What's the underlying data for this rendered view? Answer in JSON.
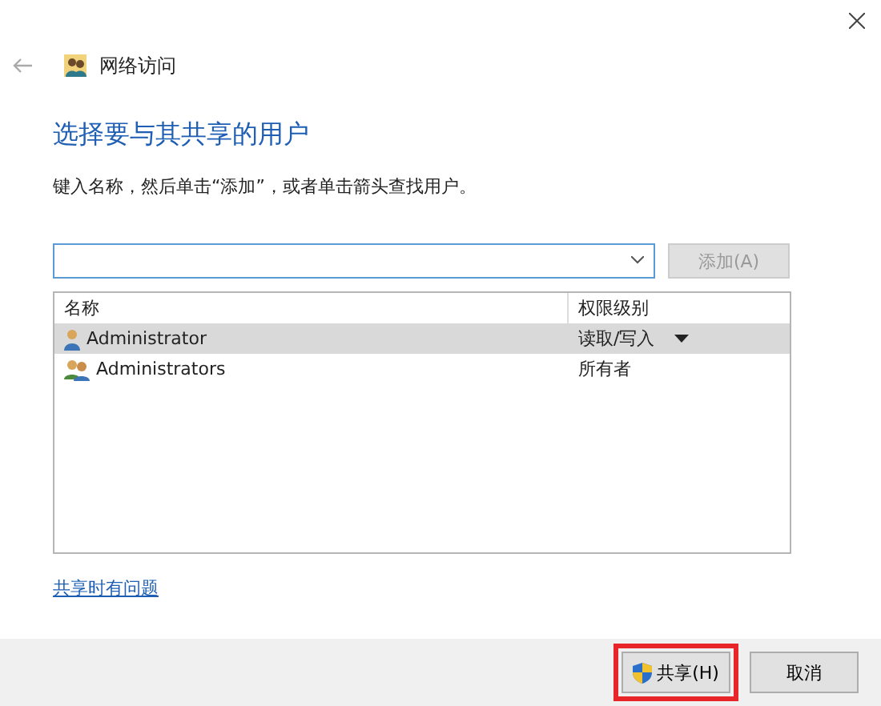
{
  "window": {
    "title": "网络访问"
  },
  "heading": "选择要与其共享的用户",
  "instruction": "键入名称，然后单击“添加”，或者单击箭头查找用户。",
  "add_button": {
    "label": "添加(A)",
    "disabled": true
  },
  "table": {
    "columns": [
      "名称",
      "权限级别"
    ],
    "rows": [
      {
        "kind": "user",
        "name": "Administrator",
        "permission": "读取/写入",
        "selected": true
      },
      {
        "kind": "group",
        "name": "Administrators",
        "permission": "所有者",
        "selected": false
      }
    ]
  },
  "help_link": "共享时有问题",
  "buttons": [
    {
      "label": "共享(H)",
      "kind": "shield",
      "highlighted": true
    },
    {
      "label": "取消",
      "kind": "plain",
      "highlighted": false
    }
  ]
}
